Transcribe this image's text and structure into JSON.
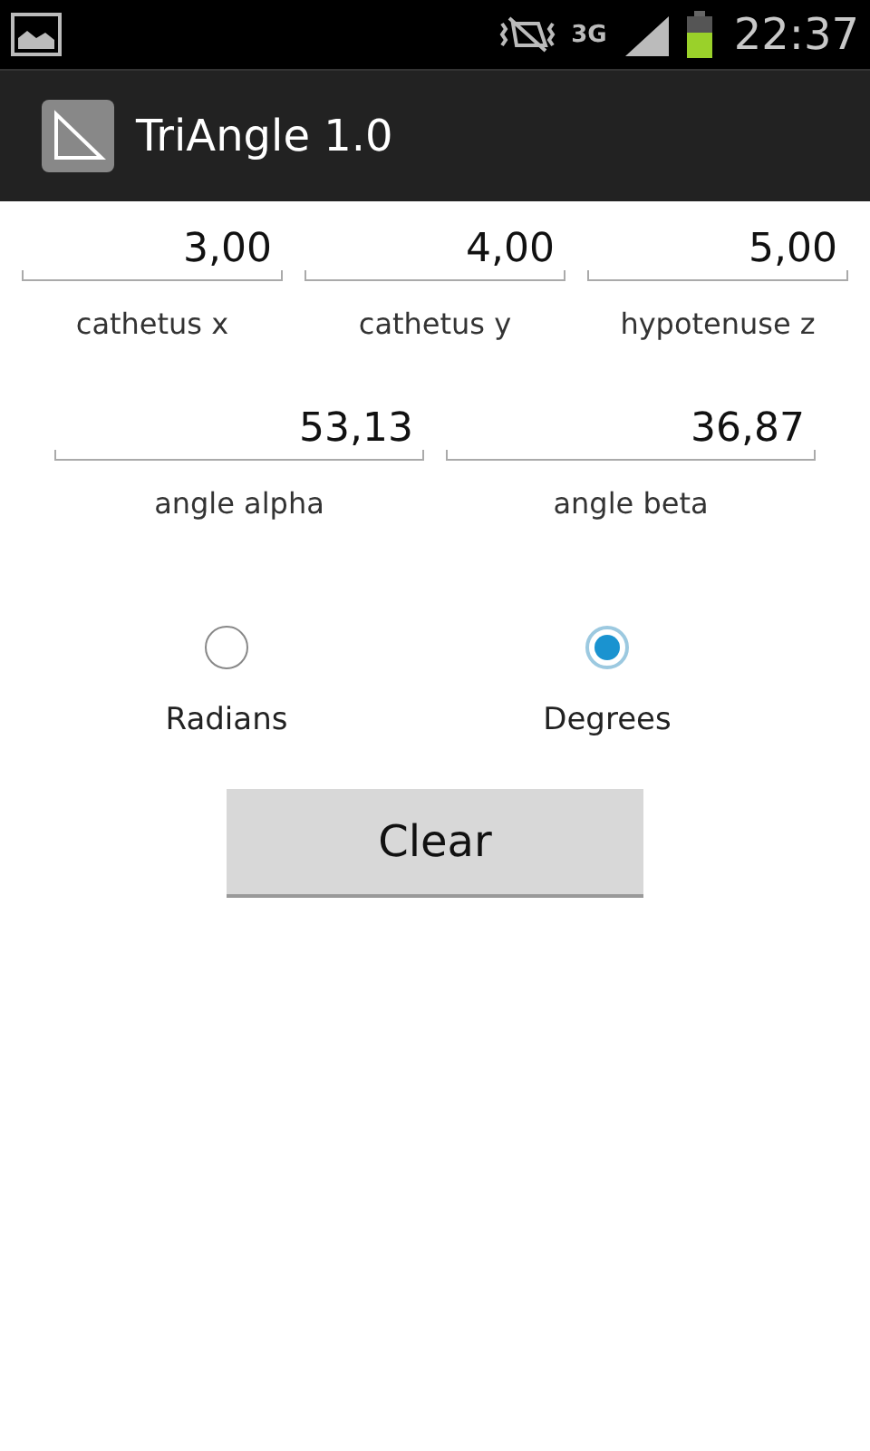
{
  "status_bar": {
    "network": "3G",
    "time": "22:37"
  },
  "action_bar": {
    "title": "TriAngle 1.0"
  },
  "side_fields": [
    {
      "value": "3,00",
      "label": "cathetus x"
    },
    {
      "value": "4,00",
      "label": "cathetus y"
    },
    {
      "value": "5,00",
      "label": "hypotenuse z"
    }
  ],
  "angle_fields": [
    {
      "value": "53,13",
      "label": "angle alpha"
    },
    {
      "value": "36,87",
      "label": "angle beta"
    }
  ],
  "units": [
    {
      "label": "Radians",
      "selected": false
    },
    {
      "label": "Degrees",
      "selected": true
    }
  ],
  "buttons": [
    {
      "label": "Clear"
    }
  ]
}
